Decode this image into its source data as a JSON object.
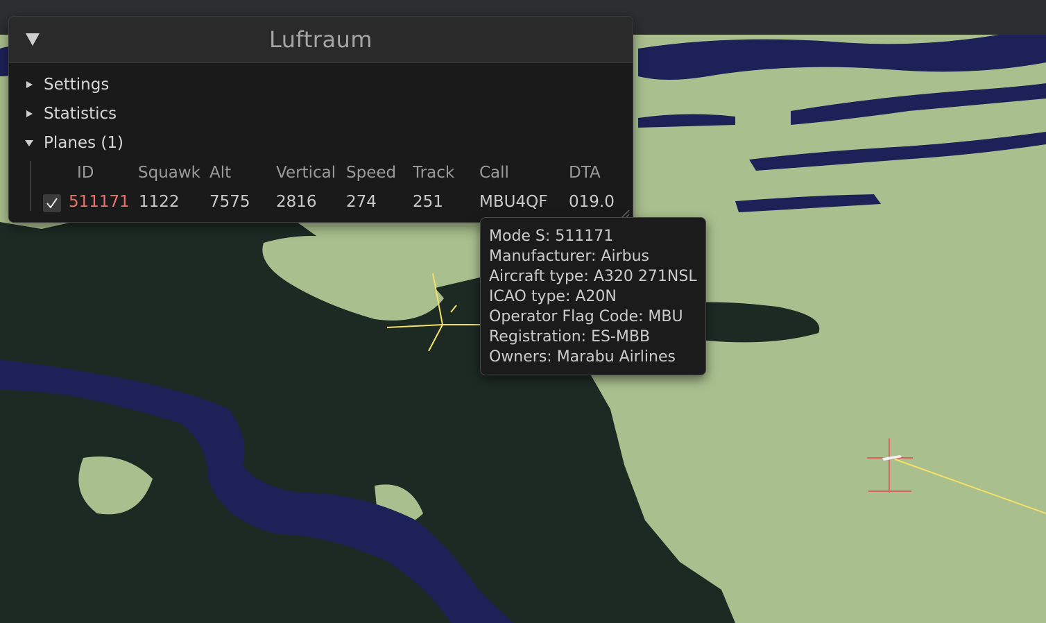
{
  "window": {
    "title": "Luftraum"
  },
  "tree": {
    "settings_label": "Settings",
    "statistics_label": "Statistics",
    "planes_label": "Planes (1)"
  },
  "table": {
    "headers": {
      "id": "ID",
      "squawk": "Squawk",
      "alt": "Alt",
      "vertical": "Vertical",
      "speed": "Speed",
      "track": "Track",
      "call": "Call",
      "dta": "DTA"
    },
    "rows": [
      {
        "selected": true,
        "id": "511171",
        "squawk": "1122",
        "alt": "7575",
        "vertical": "2816",
        "speed": "274",
        "track": "251",
        "call": "MBU4QF",
        "dta": "019.0"
      }
    ]
  },
  "tooltip": {
    "lines": [
      "Mode S: 511171",
      "Manufacturer: Airbus",
      "Aircraft type: A320 271NSL",
      "ICAO type: A20N",
      "Operator Flag Code: MBU",
      "Registration: ES-MBB",
      "Owners: Marabu Airlines"
    ]
  },
  "colors": {
    "land": "#a9bf8e",
    "forest": "#1d2a24",
    "water": "#1d2158",
    "panel_bg": "#1a1a1a",
    "title_bg": "#2a2a2a",
    "selected_id": "#e8736c",
    "track_line": "#f4e06a",
    "plane_marker": "#e06060"
  }
}
